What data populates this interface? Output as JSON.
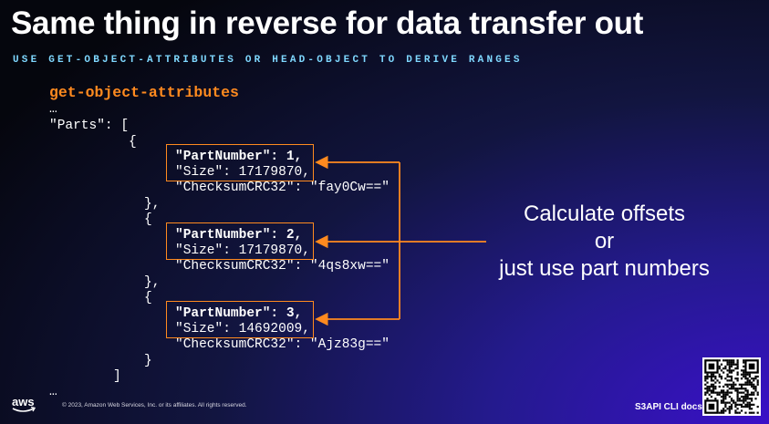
{
  "slide": {
    "title": "Same thing in reverse for data transfer out",
    "subtitle": "USE GET-OBJECT-ATTRIBUTES OR HEAD-OBJECT TO DERIVE RANGES",
    "code_title": "get-object-attributes",
    "code_lines": {
      "ellipsis_top": "…",
      "parts_open": "\"Parts\": [",
      "brace_open_1": "{",
      "part1_number": "\"PartNumber\": 1,",
      "part1_size": "\"Size\": 17179870,",
      "part1_checksum": "\"ChecksumCRC32\": \"fay0Cw==\"",
      "brace_close_1": "},",
      "brace_open_2": "{",
      "part2_number": "\"PartNumber\": 2,",
      "part2_size": "\"Size\": 17179870,",
      "part2_checksum": "\"ChecksumCRC32\": \"4qs8xw==\"",
      "brace_close_2": "},",
      "brace_open_3": "{",
      "part3_number": "\"PartNumber\": 3,",
      "part3_size": "\"Size\": 14692009,",
      "part3_checksum": "\"ChecksumCRC32\": \"Ajz83g==\"",
      "brace_close_3": "}",
      "bracket_close": "]",
      "ellipsis_bottom": "…"
    },
    "callout": {
      "line1": "Calculate offsets",
      "line2": "or",
      "line3": "just use part numbers"
    },
    "footer": {
      "copyright": "© 2023, Amazon Web Services, Inc. or its affiliates. All rights reserved.",
      "docs_label": "S3API CLI docs:",
      "logo_text": "aws"
    },
    "colors": {
      "accent_orange": "#ff8a1f",
      "subtitle_cyan": "#7fd8ff"
    },
    "icons": [
      "aws-logo-icon",
      "qr-code-icon"
    ]
  }
}
